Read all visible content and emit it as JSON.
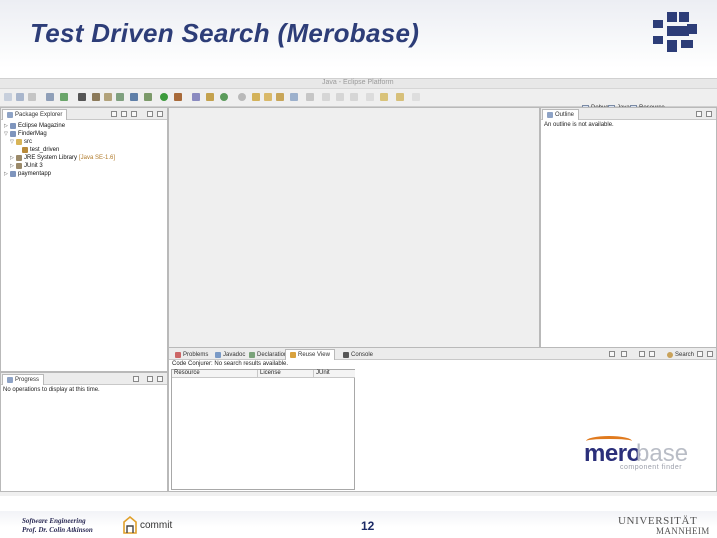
{
  "slide": {
    "title": "Test Driven Search (Merobase)",
    "page_number": "12",
    "footer_line1": "Software Engineering",
    "footer_line2": "Prof. Dr. Colin Atkinson",
    "partner_logo": "commit",
    "university_line1": "UNIVERSITÄT",
    "university_line2": "MANNHEIM",
    "brand_color": "#2d3d78"
  },
  "eclipse": {
    "window_title": "Java - Eclipse Platform",
    "perspectives": [
      "Debug",
      "Java",
      "Resource"
    ],
    "package_explorer": {
      "tab_label": "Package Explorer",
      "items": [
        {
          "label": "Eclipse Magazine",
          "icon": "project-icon",
          "indent": 0,
          "arrow": "▷"
        },
        {
          "label": "FinderMag",
          "icon": "project-icon",
          "indent": 0,
          "arrow": "▽"
        },
        {
          "label": "src",
          "icon": "folder-icon",
          "indent": 1,
          "arrow": "▽"
        },
        {
          "label": "test_driven",
          "icon": "package-icon",
          "indent": 2,
          "arrow": ""
        },
        {
          "label": "JRE System Library",
          "lib_suffix": "[Java SE-1.6]",
          "icon": "library-icon",
          "indent": 1,
          "arrow": "▷"
        },
        {
          "label": "JUnit 3",
          "icon": "library-icon",
          "indent": 1,
          "arrow": "▷"
        },
        {
          "label": "paymentapp",
          "icon": "project-icon",
          "indent": 0,
          "arrow": "▷"
        }
      ]
    },
    "outline": {
      "tab_label": "Outline",
      "message": "An outline is not available."
    },
    "progress": {
      "tab_label": "Progress",
      "message": "No operations to display at this time."
    },
    "bottom_tabs": [
      "Problems",
      "Javadoc",
      "Declaration",
      "Reuse View",
      "Console"
    ],
    "bottom_active_tab": "Reuse View",
    "reuse_view": {
      "status": "Code Conjurer: No search results available.",
      "columns": [
        "Resource",
        "License",
        "JUnit"
      ],
      "search_button": "Search"
    }
  },
  "merobase_logo": {
    "word1": "mero",
    "word2": "base",
    "tagline": "component finder",
    "accent_color": "#e07a1e"
  }
}
